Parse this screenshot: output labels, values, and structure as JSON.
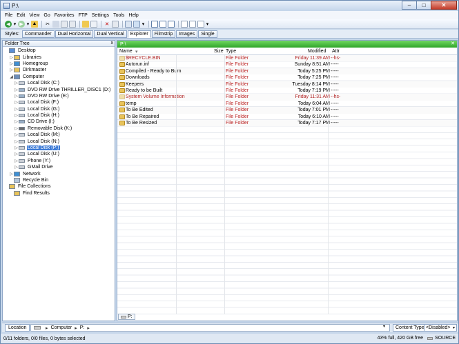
{
  "window": {
    "title": "P:\\"
  },
  "menu": [
    "File",
    "Edit",
    "View",
    "Go",
    "Favorites",
    "FTP",
    "Settings",
    "Tools",
    "Help"
  ],
  "toolbar_icons": [
    "back-icon",
    "forward-icon",
    "up-icon",
    "cut-icon",
    "copy-icon",
    "paste-icon",
    "new-folder-icon",
    "delete-icon",
    "properties-icon",
    "layout-icon",
    "view-icon",
    "explorer-icon",
    "preview-icon",
    "options-icon"
  ],
  "styles": {
    "label": "Styles:",
    "tabs": [
      "Commander",
      "Dual Horizontal",
      "Dual Vertical",
      "Explorer",
      "Filmstrip",
      "Images",
      "Single"
    ],
    "active": "Explorer"
  },
  "sidebar": {
    "title": "Folder Tree",
    "close": "x",
    "items": [
      {
        "label": "Desktop",
        "indent": 0,
        "icon": "desktop-icon"
      },
      {
        "label": "Libraries",
        "indent": 1,
        "icon": "library-icon"
      },
      {
        "label": "Homegroup",
        "indent": 1,
        "icon": "homegroup-icon"
      },
      {
        "label": "Dirkmaster",
        "indent": 1,
        "icon": "user-folder-icon"
      },
      {
        "label": "Computer",
        "indent": 1,
        "icon": "computer-icon"
      },
      {
        "label": "Local Disk (C:)",
        "indent": 2,
        "icon": "drive-icon"
      },
      {
        "label": "DVD RW Drive THRILLER_DISC1 (D:)",
        "indent": 2,
        "icon": "dvd-icon"
      },
      {
        "label": "DVD RW Drive (E:)",
        "indent": 2,
        "icon": "dvd-icon"
      },
      {
        "label": "Local Disk (F:)",
        "indent": 2,
        "icon": "drive-icon"
      },
      {
        "label": "Local Disk (G:)",
        "indent": 2,
        "icon": "drive-icon"
      },
      {
        "label": "Local Disk (H:)",
        "indent": 2,
        "icon": "drive-icon"
      },
      {
        "label": "CD Drive (I:)",
        "indent": 2,
        "icon": "cd-icon"
      },
      {
        "label": "Removable Disk (K:)",
        "indent": 2,
        "icon": "removable-icon"
      },
      {
        "label": "Local Disk (M:)",
        "indent": 2,
        "icon": "drive-icon"
      },
      {
        "label": "Local Disk (N:)",
        "indent": 2,
        "icon": "drive-icon"
      },
      {
        "label": "Local Disk (P:)",
        "indent": 2,
        "icon": "drive-icon",
        "selected": true
      },
      {
        "label": "Local Disk (U:)",
        "indent": 2,
        "icon": "drive-icon"
      },
      {
        "label": "Phone (Y:)",
        "indent": 2,
        "icon": "drive-icon"
      },
      {
        "label": "GMail Drive",
        "indent": 2,
        "icon": "drive-icon"
      },
      {
        "label": "Network",
        "indent": 1,
        "icon": "network-icon"
      },
      {
        "label": "Recycle Bin",
        "indent": 1,
        "icon": "recycle-bin-icon"
      },
      {
        "label": "File Collections",
        "indent": 0,
        "icon": "collections-icon"
      },
      {
        "label": "Find Results",
        "indent": 1,
        "icon": "find-icon"
      }
    ]
  },
  "pane": {
    "path": "P:\\",
    "tab": "P:",
    "columns": {
      "name": "Name",
      "size": "Size",
      "type": "Type",
      "modified": "Modified",
      "attr": "Attr"
    },
    "rows": [
      {
        "name": "$RECYCLE.BIN",
        "type": "File Folder",
        "modified": "Friday 11:39 AM",
        "attr": "--hs-",
        "hidden": true
      },
      {
        "name": "Autorun.inf",
        "type": "File Folder",
        "modified": "Sunday 8:51 AM",
        "attr": "-----"
      },
      {
        "name": "Compiled - Ready to Burn",
        "type": "File Folder",
        "modified": "Today 5:25 PM",
        "attr": "-----"
      },
      {
        "name": "Downloads",
        "type": "File Folder",
        "modified": "Today 7:25 PM",
        "attr": "-----"
      },
      {
        "name": "Keepers",
        "type": "File Folder",
        "modified": "Tuesday 8:14 PM",
        "attr": "-----"
      },
      {
        "name": "Ready to be Built",
        "type": "File Folder",
        "modified": "Today 7:19 PM",
        "attr": "-----"
      },
      {
        "name": "System Volume Information",
        "type": "File Folder",
        "modified": "Friday 11:31 AM",
        "attr": "--hs-",
        "hidden": true
      },
      {
        "name": "temp",
        "type": "File Folder",
        "modified": "Today 6:04 AM",
        "attr": "-----"
      },
      {
        "name": "To Be Edited",
        "type": "File Folder",
        "modified": "Today 7:01 PM",
        "attr": "-----"
      },
      {
        "name": "To Be Repaired",
        "type": "File Folder",
        "modified": "Today 6:10 AM",
        "attr": "-----"
      },
      {
        "name": "To Be Resized",
        "type": "File Folder",
        "modified": "Today 7:17 PM",
        "attr": "-----"
      }
    ]
  },
  "location": {
    "tab": "Location",
    "crumbs": [
      "Computer",
      "P:"
    ],
    "content_type_label": "Content Type",
    "content_type_value": "<Disabled>"
  },
  "status": {
    "left": "0/11 folders, 0/0 files, 0 bytes selected",
    "right": "43% full, 420 GB free",
    "source": "SOURCE"
  }
}
